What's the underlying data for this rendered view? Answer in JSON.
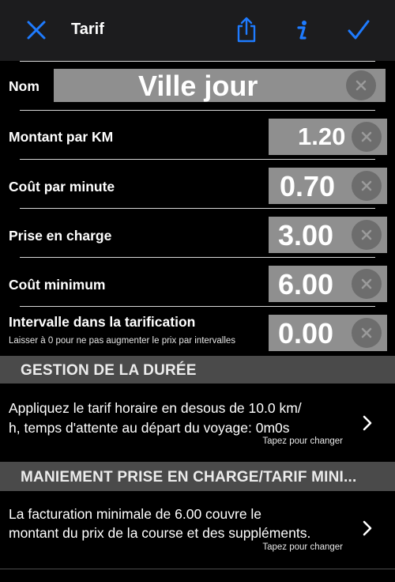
{
  "navbar": {
    "title": "Tarif",
    "close_icon": "close-icon",
    "share_icon": "share-icon",
    "info_icon": "info-icon",
    "done_icon": "checkmark-icon",
    "accent_color": "#1e7bff"
  },
  "name_row": {
    "label": "Nom",
    "value": "Ville jour"
  },
  "rows": [
    {
      "label": "Montant par KM",
      "value": "1.20"
    },
    {
      "label": "Coût par minute",
      "value": "0.70"
    },
    {
      "label": "Prise en charge",
      "value": "3.00"
    },
    {
      "label": "Coût minimum",
      "value": "6.00"
    },
    {
      "label": "Intervalle dans la tarification",
      "sublabel": "Laisser à 0 pour ne pas augmenter le prix par intervalles",
      "value": "0.00"
    }
  ],
  "sections": [
    {
      "header": "GESTION DE LA DURÉE",
      "line1": "Appliquez le tarif horaire en desous de 10.0 km/",
      "line2": "h, temps d'attente au départ du voyage: 0m0s",
      "hint": "Tapez pour changer"
    },
    {
      "header": "MANIEMENT PRISE EN CHARGE/TARIF MINI...",
      "line1": "La facturation minimale de 6.00 couvre le",
      "line2": "montant du prix de la course et des suppléments.",
      "hint": "Tapez pour changer"
    }
  ]
}
